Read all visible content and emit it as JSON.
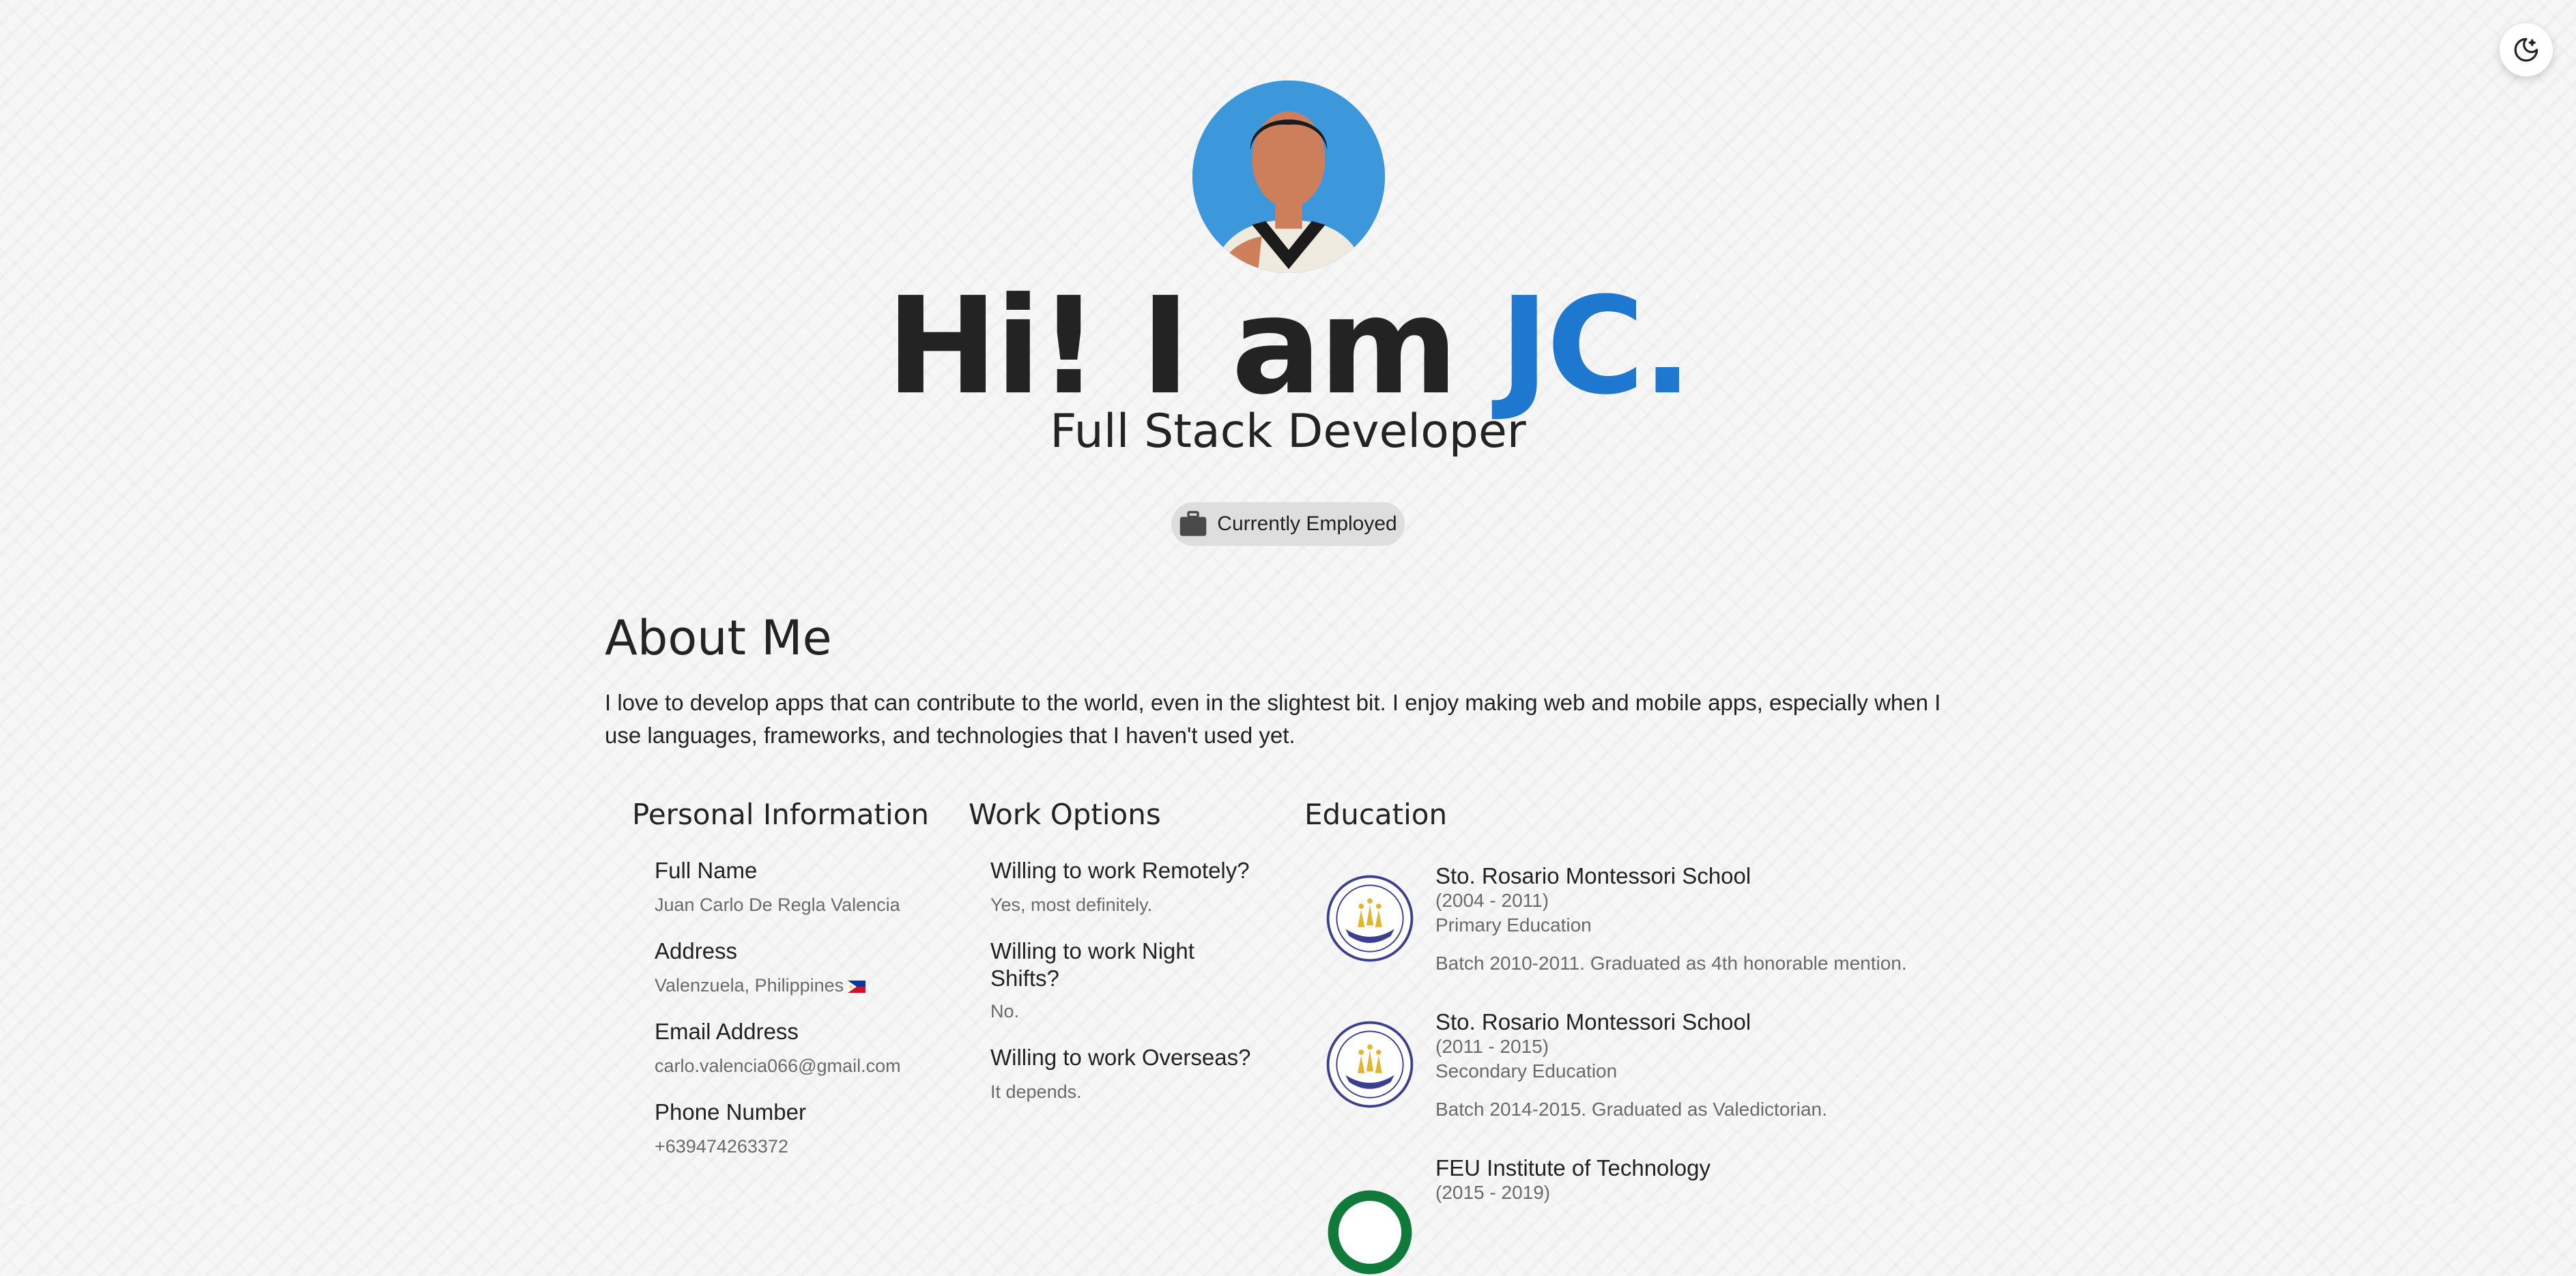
{
  "theme_toggle": {
    "icon": "moon-stars-icon"
  },
  "hero": {
    "avatar_icon": "avatar-illustration",
    "greeting": "Hi! I am ",
    "name": "JC.",
    "subtitle": "Full Stack Developer",
    "status": {
      "icon": "briefcase-icon",
      "label": "Currently Employed"
    },
    "accent_color": "#1e78cf"
  },
  "about": {
    "title": "About Me",
    "text": "I love to develop apps that can contribute to the world, even in the slightest bit. I enjoy making web and mobile apps, especially when I use languages, frameworks, and technologies that I haven't used yet."
  },
  "personal_info": {
    "heading": "Personal Information",
    "items": [
      {
        "label": "Full Name",
        "value": "Juan Carlo De Regla Valencia"
      },
      {
        "label": "Address",
        "value": "Valenzuela, Philippines"
      },
      {
        "label": "Email Address",
        "value": "carlo.valencia066@gmail.com"
      },
      {
        "label": "Phone Number",
        "value": "+639474263372"
      }
    ]
  },
  "work_options": {
    "heading": "Work Options",
    "items": [
      {
        "label": "Willing to work Remotely?",
        "value": "Yes, most definitely."
      },
      {
        "label": "Willing to work Night Shifts?",
        "value": "No."
      },
      {
        "label": "Willing to work Overseas?",
        "value": "It depends."
      }
    ]
  },
  "education": {
    "heading": "Education",
    "items": [
      {
        "school": "Sto. Rosario Montessori School",
        "years": "(2004 - 2011)",
        "level": "Primary Education",
        "note": "Batch 2010-2011. Graduated as 4th honorable mention."
      },
      {
        "school": "Sto. Rosario Montessori School",
        "years": "(2011 - 2015)",
        "level": "Secondary Education",
        "note": "Batch 2014-2015. Graduated as Valedictorian."
      },
      {
        "school": "FEU Institute of Technology",
        "years": "(2015 - 2019)"
      }
    ]
  }
}
